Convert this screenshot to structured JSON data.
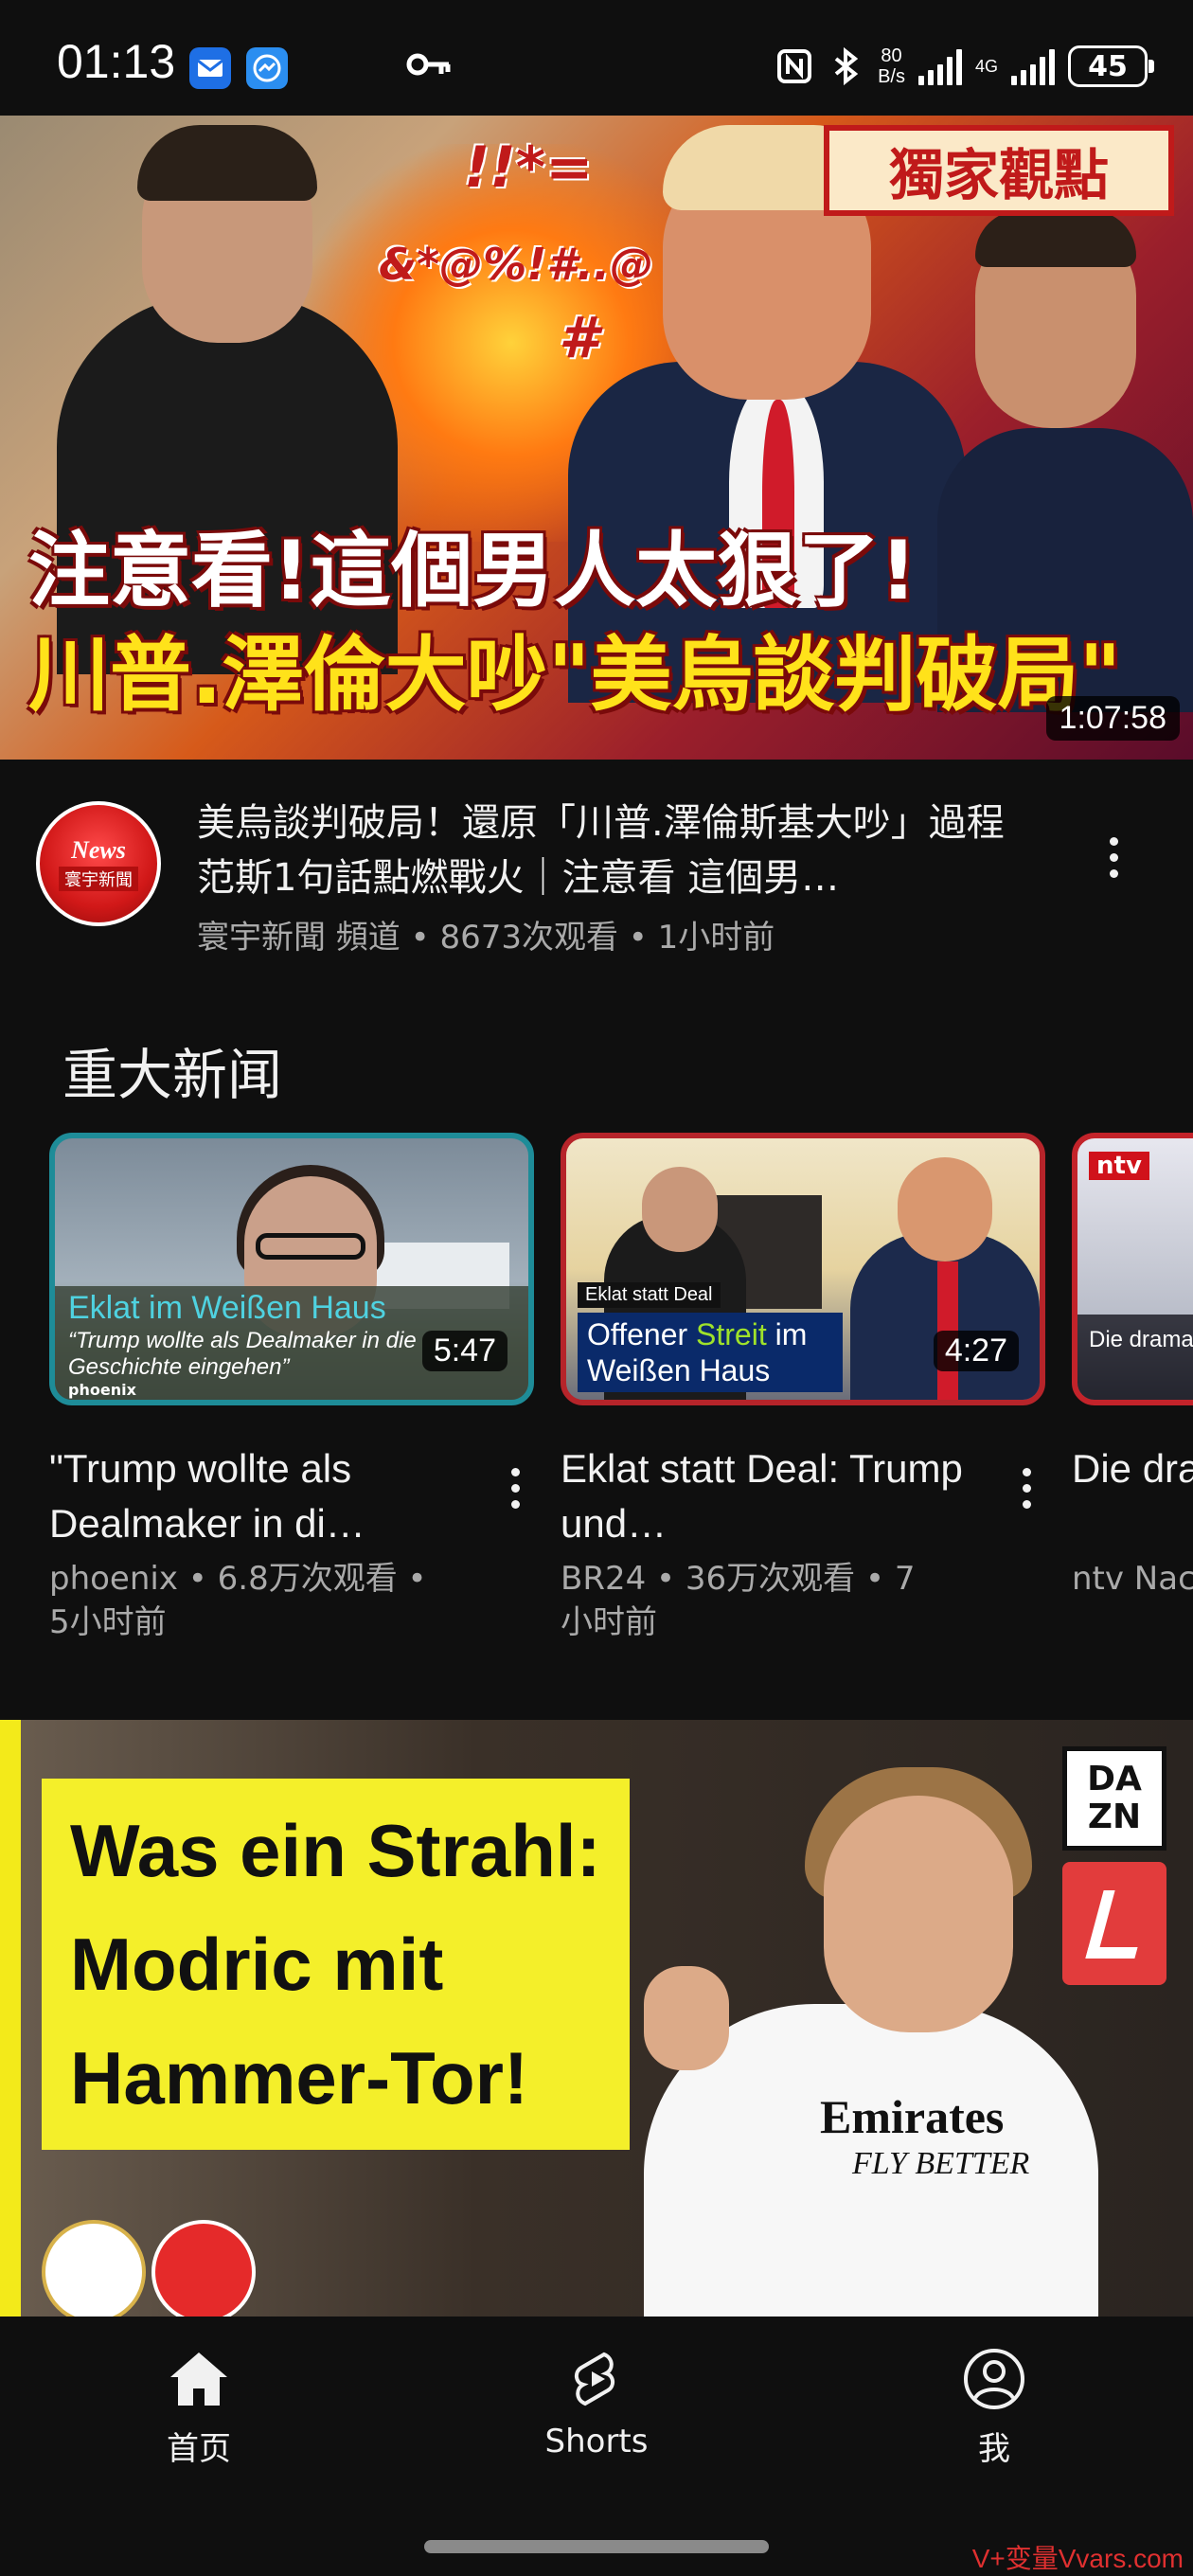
{
  "status_bar": {
    "time": "01:13",
    "net_speed_value": "80",
    "net_speed_unit": "B/s",
    "network": "4G",
    "battery": "45",
    "icons": [
      "mail-icon",
      "messenger-icon",
      "vpn-key-icon",
      "nfc-icon",
      "bluetooth-icon",
      "signal-icon",
      "battery-icon"
    ]
  },
  "main_video": {
    "badge": "獨家觀點",
    "symbols_1": "!!*=",
    "symbols_2": "&*@%!#..@",
    "symbols_3": "#",
    "overlay_line1": "注意看!這個男人太狠了!",
    "overlay_line2": "川普.澤倫大吵\"美烏談判破局\"",
    "duration": "1:07:58",
    "channel_logo_top": "News",
    "channel_logo_bottom": "寰宇新聞",
    "title": "美烏談判破局！還原「川普.澤倫斯基大吵」過程 范斯1句話點燃戰火｜注意看 這個男…",
    "subtitle": "寰宇新聞 頻道 • 8673次观看 • 1小时前"
  },
  "section": {
    "title": "重大新闻",
    "cards": [
      {
        "thumb_caption1": "Eklat im Weißen Haus",
        "thumb_caption2": "“Trump wollte als Dealmaker in die Geschichte eingehen”",
        "thumb_caption3": "phoenix",
        "duration": "5:47",
        "title": "\"Trump wollte als Dealmaker in di…",
        "meta": "phoenix • 6.8万次观看 • 5小时前"
      },
      {
        "thumb_label1": "Eklat statt Deal",
        "thumb_label2_a": "Offener ",
        "thumb_label2_b": "Streit",
        "thumb_label2_c": " im Weißen Haus",
        "duration": "4:27",
        "title": "Eklat statt Deal: Trump und…",
        "meta": "BR24 • 36万次观看 • 7小时前"
      },
      {
        "thumb_logo": "ntv",
        "thumb_caption": "Die drama Abreise na",
        "title": "Die dra Minute",
        "meta": "ntv Nac 万次观看"
      }
    ]
  },
  "second_video": {
    "headline_1": "Was ein Strahl:",
    "headline_2": "Modric mit",
    "headline_3": "Hammer-Tor!",
    "sponsor_1": "Emirates",
    "sponsor_2": "FLY BETTER",
    "logo_dazn_1": "DA",
    "logo_dazn_2": "ZN"
  },
  "bottom_nav": {
    "items": [
      {
        "label": "首页",
        "icon": "home-icon"
      },
      {
        "label": "Shorts",
        "icon": "shorts-icon"
      },
      {
        "label": "我",
        "icon": "account-icon"
      }
    ]
  },
  "watermark": "V+变量Vvars.com"
}
